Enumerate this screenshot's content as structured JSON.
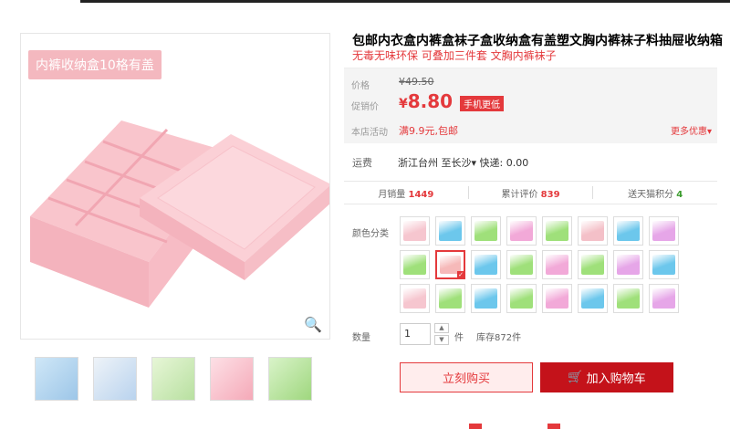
{
  "product": {
    "title": "包邮内衣盒内裤盒袜子盒收纳盒有盖塑文胸内裤袜子料抽屉收纳箱",
    "subtitle": "无毒无味环保 可叠加三件套 文胸内裤袜子",
    "image_label": "内裤收纳盒10格有盖"
  },
  "pricing": {
    "price_label": "价格",
    "original_price": "¥49.50",
    "promo_label": "促销价",
    "currency": "¥",
    "current_price": "8.80",
    "mobile_tag": "手机更低",
    "activity_label": "本店活动",
    "activity_text": "满9.9元,包邮",
    "more_offers": "更多优惠▾"
  },
  "shipping": {
    "label": "运费",
    "text": "浙江台州  至长沙▾  快递: 0.00"
  },
  "stats": {
    "monthly_label": "月销量",
    "monthly_value": "1449",
    "reviews_label": "累计评价",
    "reviews_value": "839",
    "points_label": "送天猫积分",
    "points_value": "4"
  },
  "options": {
    "color_label": "颜色分类",
    "swatch_colors": [
      "#f6c6cf",
      "#6cc7ec",
      "#9fe07a",
      "#f2a9d8",
      "#9fe07a",
      "#f4c0c8",
      "#6cc7ec",
      "#e6a6e8",
      "#9fe07a",
      "#f6b9b9",
      "#6cc7ec",
      "#9fe07a",
      "#f2a9d8",
      "#9fe07a",
      "#e6a6e8",
      "#6cc7ec",
      "#f6c6cf",
      "#9fe07a",
      "#6cc7ec",
      "#9fe07a",
      "#f2a9d8",
      "#6cc7ec",
      "#9fe07a",
      "#e6a6e8"
    ],
    "selected_index": 9
  },
  "quantity": {
    "label": "数量",
    "value": "1",
    "unit": "件",
    "stock": "库存872件"
  },
  "actions": {
    "buy_now": "立刻购买",
    "add_to_cart": "加入购物车"
  },
  "icons": {
    "zoom": "search-icon",
    "cart": "cart-icon"
  }
}
